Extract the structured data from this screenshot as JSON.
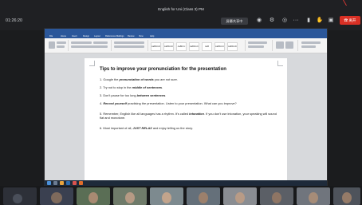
{
  "meeting": {
    "title": "English for Uni (Class 3) PM",
    "timer": "01:26:20",
    "share_label": "屏幕共享中",
    "leave_label": "离开"
  },
  "toolbar_icons": [
    "participants-icon",
    "settings-icon",
    "camera-icon",
    "more-icon",
    "mic-icon",
    "hand-icon",
    "share-screen-icon"
  ],
  "ribbon": {
    "tabs": [
      "File",
      "Home",
      "Insert",
      "Design",
      "Layout",
      "References",
      "Mailings",
      "Review",
      "View",
      "Help"
    ],
    "styles": [
      "AaBbCcDc",
      "AaBbCcDc",
      "AaBbCc",
      "AaBbCcC",
      "AaB",
      "AaBbCcC",
      "AaBbCcDc"
    ]
  },
  "document": {
    "heading": "Tips to improve your pronunciation for the presentation",
    "items": [
      "1. Google the pronunciation of words you are not sure.",
      "2. Try not to stop in the middle of sentences.",
      "3. Don't pause for too long between sentences.",
      "4. Record yourself practising the presentation. Listen to your presentation. What can you improve?",
      "5. Remember, English like all languages has a rhythm. It's called intonation. If you don't use intonation, your speaking will sound flat and monotone.",
      "6. Most important of all, JUST RELAX and enjoy telling us the story."
    ]
  },
  "colors": {
    "accent": "#2b579a",
    "leave": "#d93025",
    "background": "#1b1c1e"
  }
}
